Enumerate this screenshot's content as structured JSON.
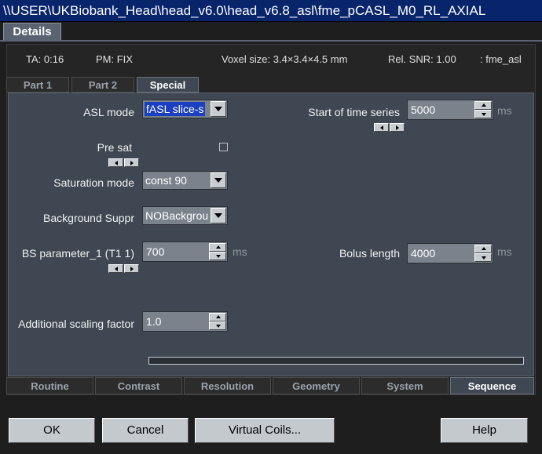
{
  "window": {
    "title": "\\\\USER\\UKBiobank_Head\\head_v6.0\\head_v6.8_asl\\fme_pCASL_M0_RL_AXIAL"
  },
  "details_tab": {
    "label": "Details"
  },
  "info": {
    "ta": "TA: 0:16",
    "pm": "PM: FIX",
    "voxel": "Voxel size: 3.4×3.4×4.5 mm",
    "snr": "Rel. SNR: 1.00",
    "seq": ": fme_asl"
  },
  "sub_tabs": [
    {
      "label": "Part 1",
      "active": false
    },
    {
      "label": "Part 2",
      "active": false
    },
    {
      "label": "Special",
      "active": true
    }
  ],
  "fields": {
    "asl_mode": {
      "label": "ASL mode",
      "value": "fASL slice-s"
    },
    "start_time_series": {
      "label": "Start of time  series",
      "value": "5000",
      "unit": "ms"
    },
    "pre_sat": {
      "label": "Pre sat",
      "checked": false
    },
    "saturation_mode": {
      "label": "Saturation mode",
      "value": "const 90"
    },
    "background_suppr": {
      "label": "Background Suppr",
      "value": "NOBackgrou"
    },
    "bs_parameter_1": {
      "label": "BS parameter_1 (T1 1)",
      "value": "700",
      "unit": "ms"
    },
    "bolus_length": {
      "label": "Bolus length",
      "value": "4000",
      "unit": "ms"
    },
    "additional_scaling": {
      "label": "Additional scaling factor",
      "value": "1.0"
    }
  },
  "bottom_tabs": [
    {
      "label": "Routine",
      "active": false
    },
    {
      "label": "Contrast",
      "active": false
    },
    {
      "label": "Resolution",
      "active": false
    },
    {
      "label": "Geometry",
      "active": false
    },
    {
      "label": "System",
      "active": false
    },
    {
      "label": "Sequence",
      "active": true
    }
  ],
  "buttons": {
    "ok": "OK",
    "cancel": "Cancel",
    "virtual_coils": "Virtual Coils...",
    "help": "Help"
  }
}
